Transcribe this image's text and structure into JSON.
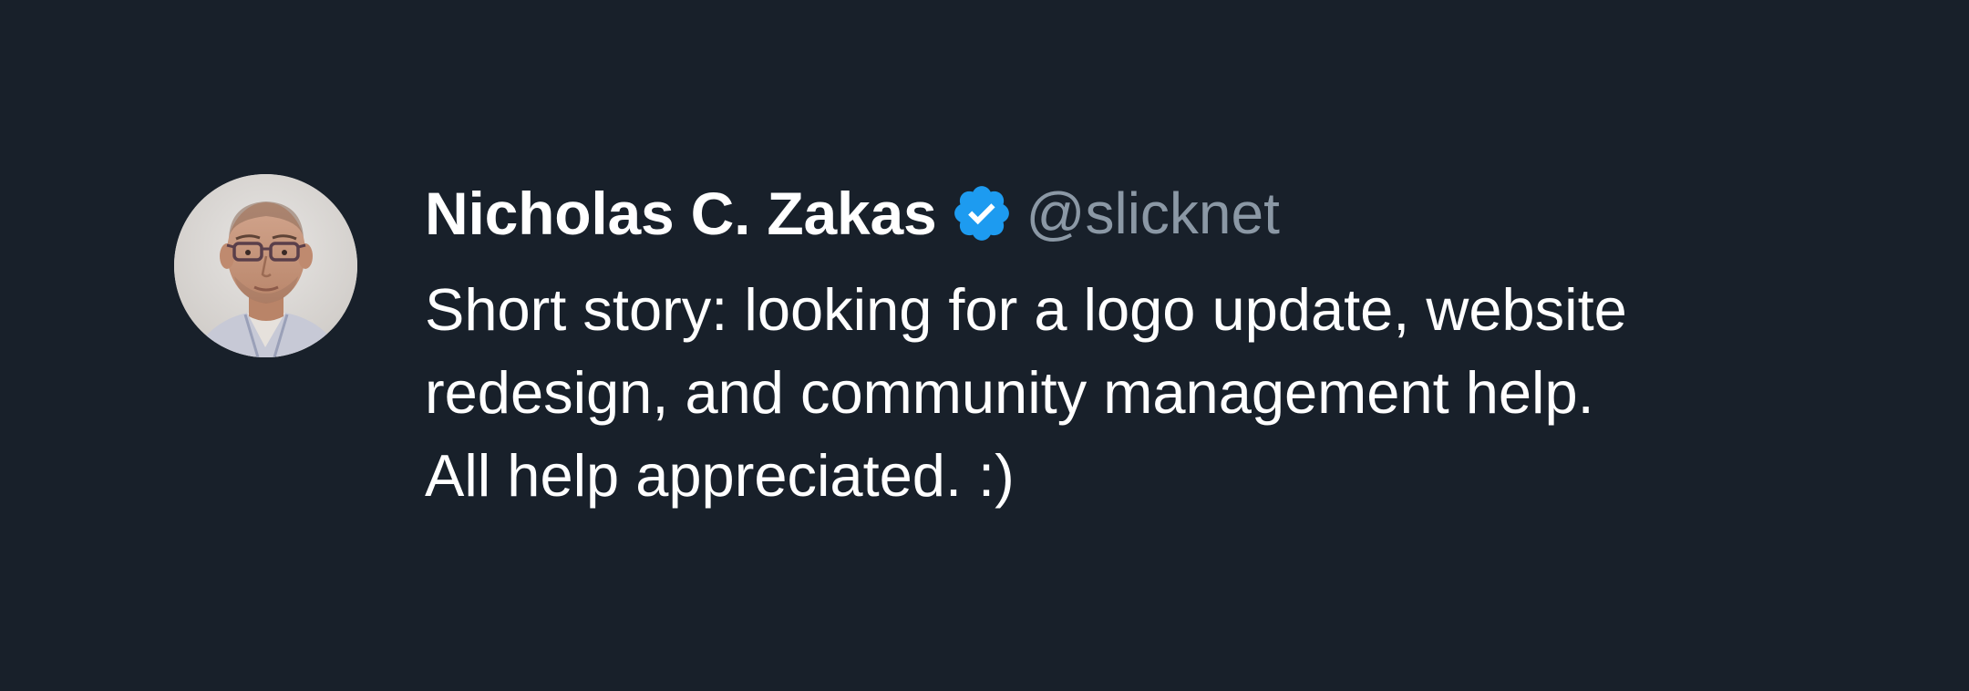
{
  "author": {
    "name": "Nicholas C. Zakas",
    "handle": "@slicknet",
    "verified_icon": "verified-badge-icon",
    "avatar": "profile-photo"
  },
  "tweet": {
    "lines": [
      "Short story: looking for a logo update, website",
      "redesign, and community management help.",
      "All help appreciated. :)"
    ]
  },
  "colors": {
    "background": "#18202a",
    "name": "#ffffff",
    "handle": "#8b98a5",
    "text": "#ffffff",
    "verified": "#1d9bf0"
  }
}
